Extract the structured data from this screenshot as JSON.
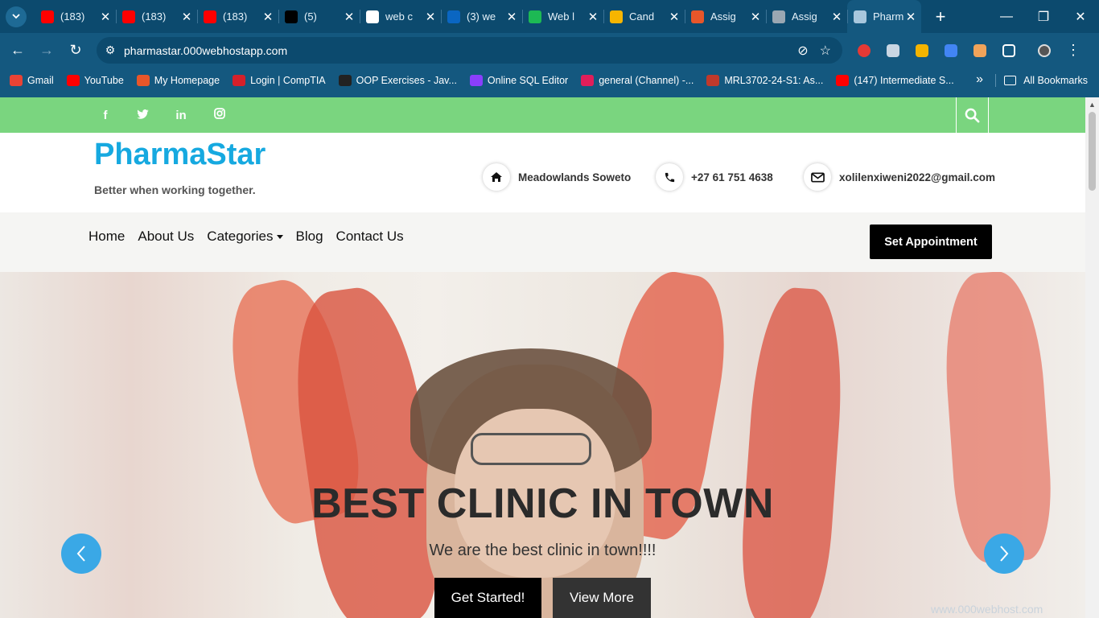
{
  "browser": {
    "tabs": [
      {
        "title": "(183)",
        "favicon": "youtube-icon",
        "color": "#ff0000"
      },
      {
        "title": "(183)",
        "favicon": "youtube-icon",
        "color": "#ff0000"
      },
      {
        "title": "(183)",
        "favicon": "youtube-icon",
        "color": "#ff0000"
      },
      {
        "title": "(5)",
        "favicon": "x-icon",
        "color": "#000000"
      },
      {
        "title": "web c",
        "favicon": "google-icon",
        "color": "#ffffff"
      },
      {
        "title": "(3) we",
        "favicon": "linkedin-icon",
        "color": "#0a66c2"
      },
      {
        "title": "Web l",
        "favicon": "web-icon",
        "color": "#1db954"
      },
      {
        "title": "Cand",
        "favicon": "candidate-icon",
        "color": "#f7b500"
      },
      {
        "title": "Assig",
        "favicon": "assignment-icon",
        "color": "#e8562a"
      },
      {
        "title": "Assig",
        "favicon": "globe-icon",
        "color": "#9aa7b2"
      },
      {
        "title": "Pharm",
        "favicon": "pharmastar-icon",
        "color": "#a8c7dd",
        "active": true
      }
    ],
    "url": "pharmastar.000webhostapp.com",
    "bookmarks": [
      {
        "label": "Gmail",
        "color": "#ea4335"
      },
      {
        "label": "YouTube",
        "color": "#ff0000"
      },
      {
        "label": "My Homepage",
        "color": "#e8562a"
      },
      {
        "label": "Login | CompTIA",
        "color": "#d6202a"
      },
      {
        "label": "OOP Exercises - Jav...",
        "color": "#222222"
      },
      {
        "label": "Online SQL Editor",
        "color": "#8a3ffc"
      },
      {
        "label": "general (Channel) -...",
        "color": "#e01e5a"
      },
      {
        "label": "MRL3702-24-S1: As...",
        "color": "#c0392b"
      },
      {
        "label": "(147) Intermediate S...",
        "color": "#ff0000"
      }
    ],
    "all_bookmarks": "All Bookmarks"
  },
  "site": {
    "brand": "PharmaStar",
    "tagline": "Better when working together.",
    "contacts": {
      "address": "Meadowlands Soweto",
      "phone": "+27 61 751 4638",
      "email": "xolilenxiweni2022@gmail.com"
    },
    "menu": {
      "home": "Home",
      "about": "About Us",
      "categories": "Categories",
      "blog": "Blog",
      "contact": "Contact Us"
    },
    "appointment": "Set Appointment",
    "hero": {
      "title": "BEST CLINIC IN TOWN",
      "subtitle": "We are the best clinic in town!!!!",
      "start": "Get Started!",
      "more": "View More"
    },
    "watermark": "www.000webhost.com"
  },
  "colors": {
    "chrome_dark": "#0c4a6e",
    "chrome": "#14587f",
    "topstrip": "#7ad57f",
    "brand": "#16a9e0",
    "arrow": "#3aa8e6"
  }
}
